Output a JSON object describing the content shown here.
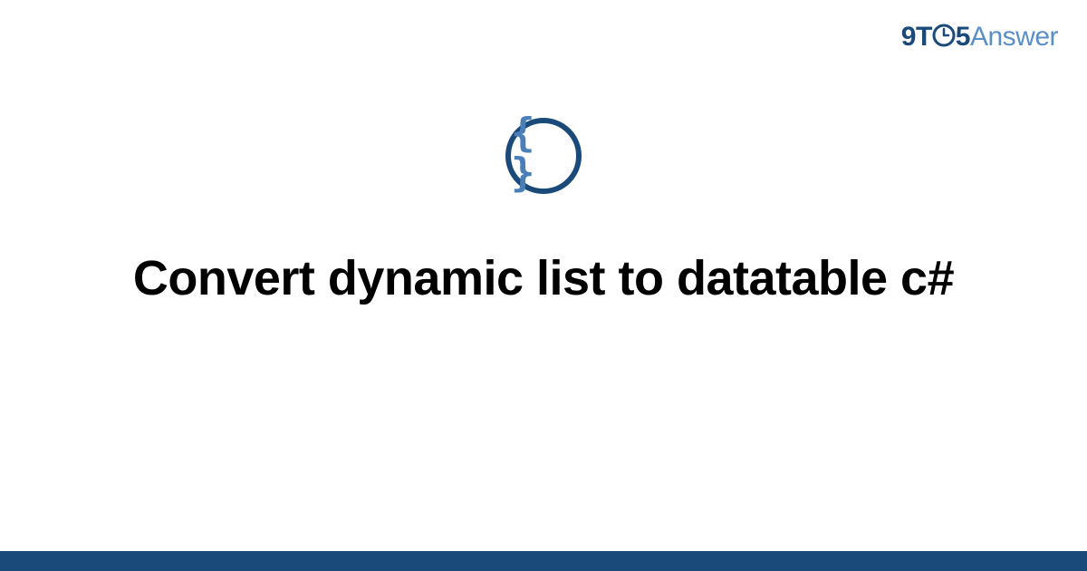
{
  "brand": {
    "nine": "9",
    "t": "T",
    "five": "5",
    "answer": "Answer"
  },
  "icon": {
    "name": "code-braces-icon",
    "glyph": "{ }"
  },
  "title": "Convert dynamic list to datatable c#",
  "colors": {
    "primary_dark": "#1a4a7a",
    "primary_light": "#5a8fc7",
    "brace_color": "#4a7fb8"
  }
}
